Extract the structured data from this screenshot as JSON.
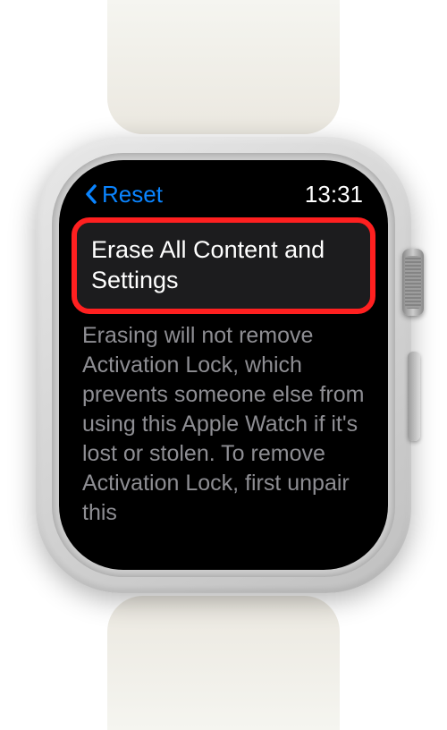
{
  "header": {
    "back_label": "Reset",
    "time": "13:31"
  },
  "main": {
    "erase_button_label": "Erase All Content and Settings",
    "description": "Erasing will not remove Activation Lock, which prevents someone else from using this Apple Watch if it's lost or stolen. To remove Activation Lock, first unpair this"
  },
  "colors": {
    "accent": "#0a84ff",
    "highlight": "#ff2020",
    "text_primary": "#ffffff",
    "text_secondary": "#8e8e93",
    "button_bg": "#1c1c1e"
  }
}
